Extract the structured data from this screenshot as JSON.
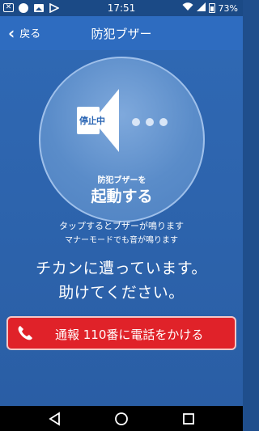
{
  "status_bar": {
    "time": "17:51",
    "battery": "73%",
    "icons": [
      "notification-x-icon",
      "circle-icon",
      "image-icon",
      "app-icon",
      "wifi-icon",
      "signal-icon",
      "battery-icon"
    ]
  },
  "app_bar": {
    "back_label": "戻る",
    "title": "防犯ブザー"
  },
  "buzzer": {
    "state_label": "停止中",
    "sub_label": "防犯ブザーを",
    "main_label": "起動する"
  },
  "hints": {
    "line1": "タップするとブザーが鳴ります",
    "line2": "マナーモードでも音が鳴ります"
  },
  "message": {
    "line1": "チカンに遭っています。",
    "line2": "助けてください。"
  },
  "call_button": {
    "label": "通報 110番に電話をかける"
  },
  "colors": {
    "background": "#2f68b3",
    "app_bar": "#2e6cc0",
    "call_button": "#e02229"
  }
}
